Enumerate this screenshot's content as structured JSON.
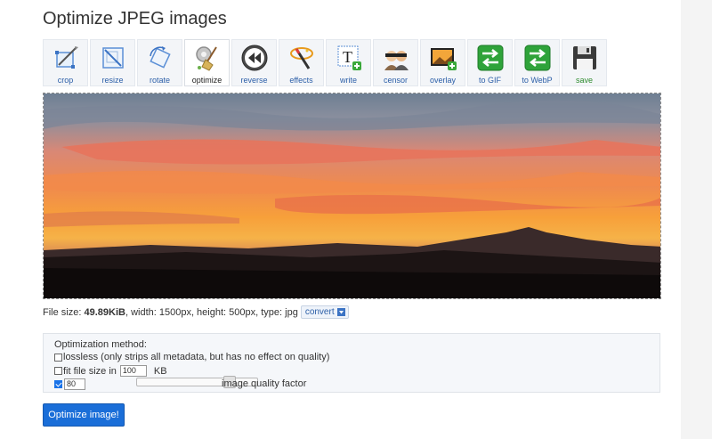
{
  "page": {
    "title": "Optimize JPEG images"
  },
  "toolbar": {
    "items": [
      {
        "label": "crop",
        "icon": "crop-icon"
      },
      {
        "label": "resize",
        "icon": "resize-icon"
      },
      {
        "label": "rotate",
        "icon": "rotate-icon"
      },
      {
        "label": "optimize",
        "icon": "optimize-broom-icon",
        "active": true
      },
      {
        "label": "reverse",
        "icon": "reverse-icon"
      },
      {
        "label": "effects",
        "icon": "effects-wand-icon"
      },
      {
        "label": "write",
        "icon": "write-text-icon"
      },
      {
        "label": "censor",
        "icon": "censor-icon"
      },
      {
        "label": "overlay",
        "icon": "overlay-icon"
      },
      {
        "label": "to GIF",
        "icon": "convert-arrows-icon"
      },
      {
        "label": "to WebP",
        "icon": "convert-arrows-icon"
      },
      {
        "label": "save",
        "icon": "floppy-disk-icon"
      }
    ]
  },
  "file_info": {
    "size_prefix": "File size: ",
    "size": "49.89KiB",
    "details": ", width: 1500px, height: 500px, type: jpg",
    "convert_label": "convert"
  },
  "options": {
    "title": "Optimization method:",
    "lossless_label": "lossless (only strips all metadata, but has no effect on quality)",
    "lossless_checked": false,
    "fit_size_label": "fit file size in",
    "fit_size_checked": false,
    "fit_size_value": "100",
    "fit_size_unit": "KB",
    "quality_checked": true,
    "quality_value": "80",
    "quality_slider_fraction": 0.8,
    "quality_label": "image quality factor"
  },
  "submit": {
    "label": "Optimize image!"
  },
  "colors": {
    "accent": "#1a6ed8",
    "link": "#2c5fa8",
    "save_green": "#2e8b2e"
  }
}
